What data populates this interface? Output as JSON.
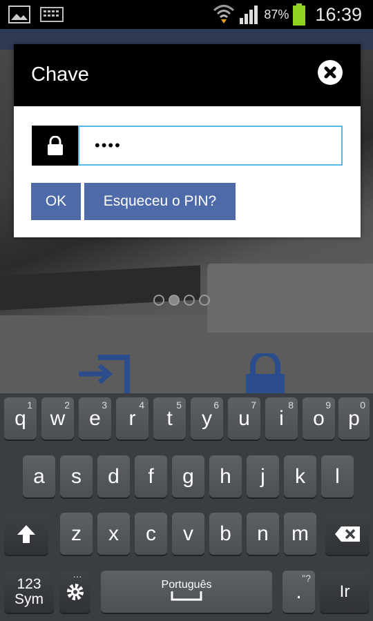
{
  "status_bar": {
    "battery_percent": "87%",
    "time": "16:39",
    "icons": [
      "image-icon",
      "keyboard-icon",
      "wifi-icon",
      "signal-icon",
      "battery-icon"
    ]
  },
  "dialog": {
    "title": "Chave",
    "pin_value": "••••",
    "ok_label": "OK",
    "forgot_label": "Esqueceu o PIN?",
    "accent": "#4f6aa8",
    "input_border": "#4fb8e6"
  },
  "keyboard": {
    "row1": [
      {
        "label": "q",
        "num": "1"
      },
      {
        "label": "w",
        "num": "2"
      },
      {
        "label": "e",
        "num": "3"
      },
      {
        "label": "r",
        "num": "4"
      },
      {
        "label": "t",
        "num": "5"
      },
      {
        "label": "y",
        "num": "6"
      },
      {
        "label": "u",
        "num": "7"
      },
      {
        "label": "i",
        "num": "8"
      },
      {
        "label": "o",
        "num": "9"
      },
      {
        "label": "p",
        "num": "0"
      }
    ],
    "row2": [
      "a",
      "s",
      "d",
      "f",
      "g",
      "h",
      "j",
      "k",
      "l"
    ],
    "row3": [
      "z",
      "x",
      "c",
      "v",
      "b",
      "n",
      "m"
    ],
    "sym_label_1": "123",
    "sym_label_2": "Sym",
    "space_label": "Português",
    "period_label": ".",
    "period_hint": "\"?",
    "go_label": "Ir"
  }
}
